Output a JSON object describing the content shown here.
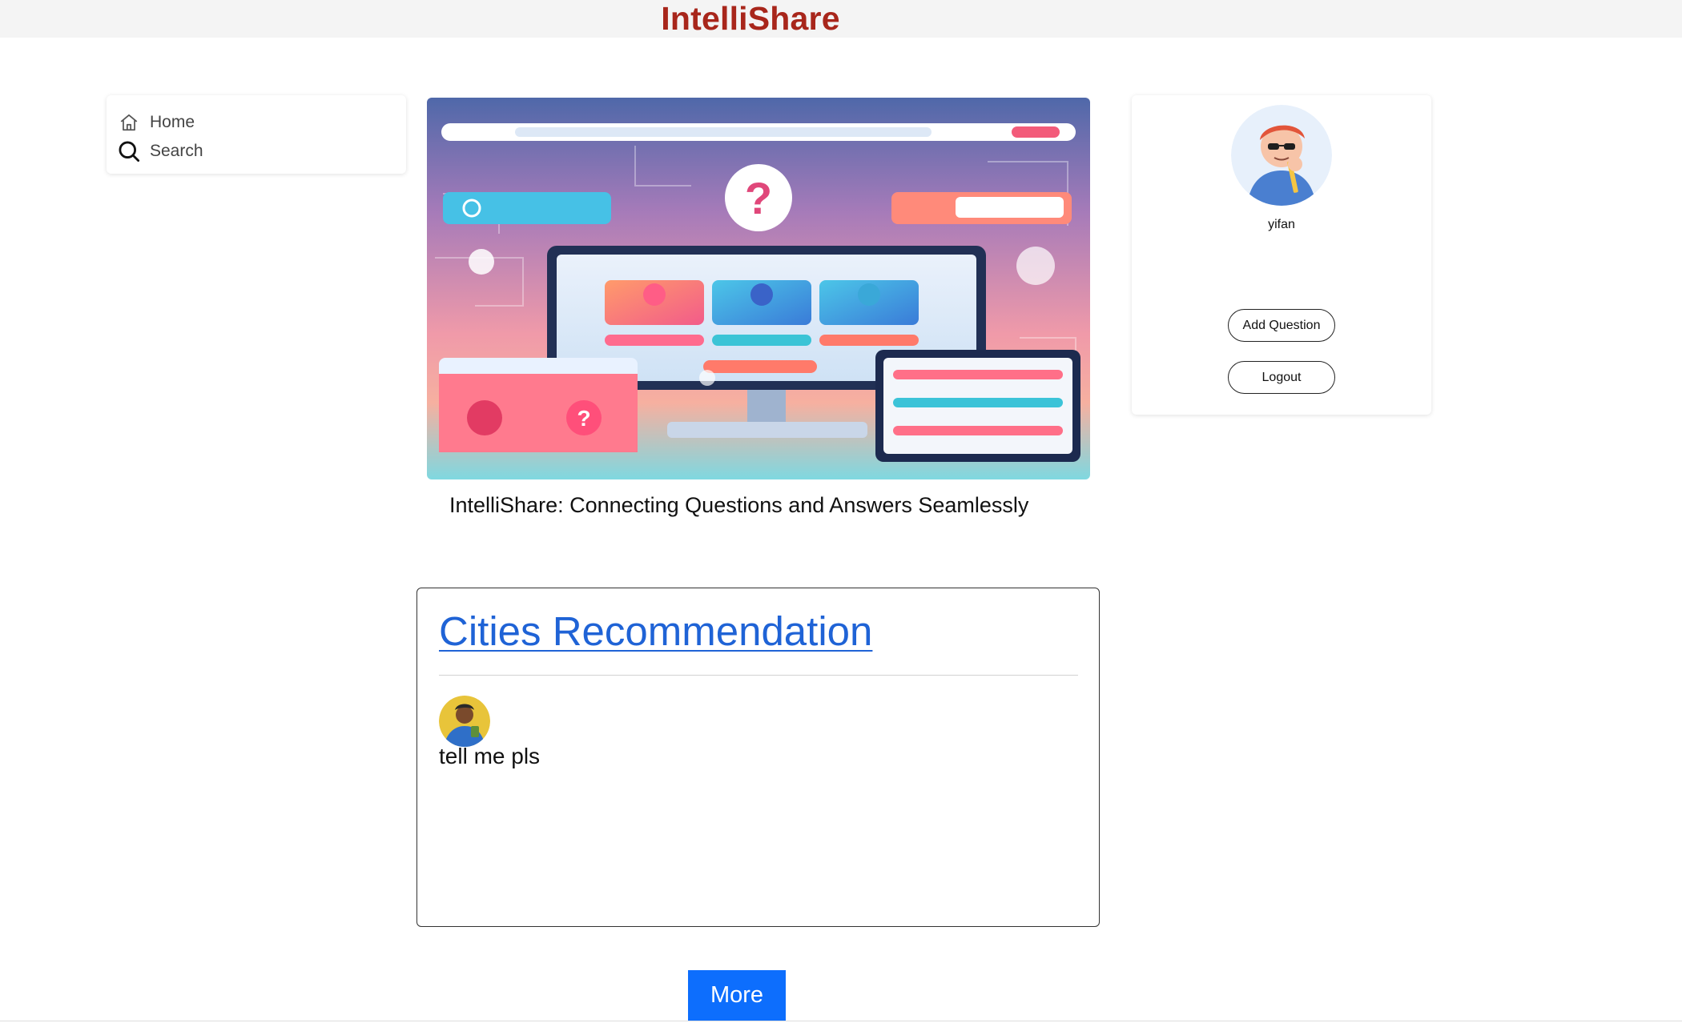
{
  "header": {
    "brand": "IntelliShare",
    "brand_color": "#a8261b"
  },
  "nav": {
    "items": [
      {
        "label": "Home",
        "icon": "home-icon"
      },
      {
        "label": "Search",
        "icon": "search-icon"
      }
    ]
  },
  "hero": {
    "image": "qa-platform-illustration",
    "caption": "IntelliShare: Connecting Questions and Answers Seamlessly"
  },
  "profile": {
    "username": "yifan",
    "avatar": "user-avatar",
    "add_question_label": "Add Question",
    "logout_label": "Logout"
  },
  "question": {
    "title": "Cities Recommendation",
    "title_color": "#1f63d6",
    "author_avatar": "author-avatar",
    "body": "tell me pls"
  },
  "more_label": "More",
  "more_color": "#0d6efd"
}
